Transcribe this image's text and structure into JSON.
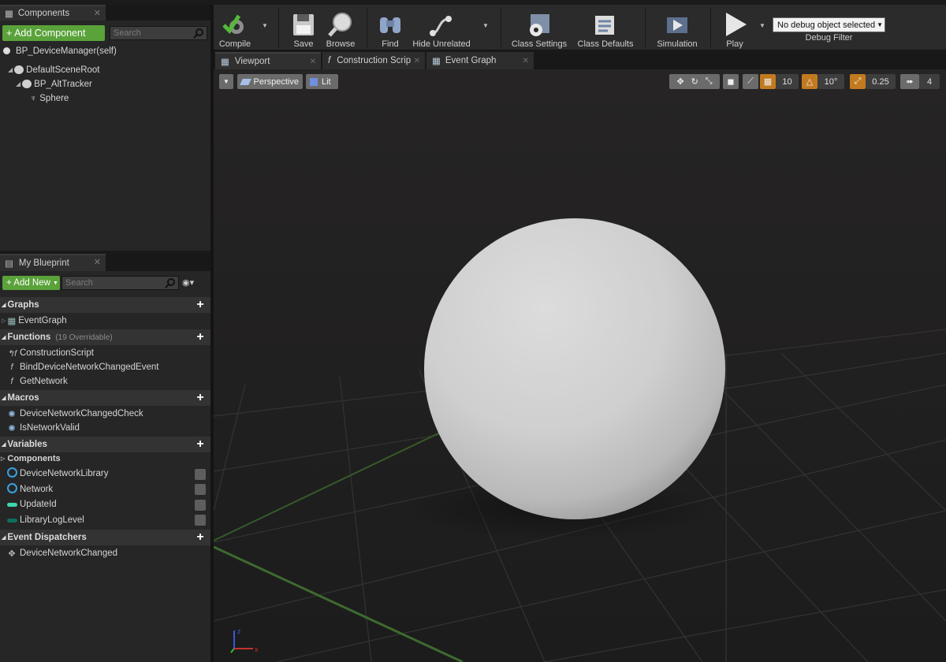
{
  "components_panel": {
    "tab_label": "Components",
    "add_component_label": "+ Add Component",
    "search_placeholder": "Search",
    "self_item": "BP_DeviceManager(self)",
    "tree": [
      "DefaultSceneRoot",
      "BP_AltTracker",
      "Sphere"
    ]
  },
  "my_blueprint": {
    "tab_label": "My Blueprint",
    "add_new_label": "+ Add New",
    "search_placeholder": "Search",
    "sections": {
      "graphs": "Graphs",
      "functions": "Functions",
      "functions_note": "(19 Overridable)",
      "macros": "Macros",
      "variables": "Variables",
      "components_sub": "Components",
      "event_dispatchers": "Event Dispatchers"
    },
    "graphs": [
      "EventGraph"
    ],
    "functions": [
      "ConstructionScript",
      "BindDeviceNetworkChangedEvent",
      "GetNetwork"
    ],
    "macros": [
      "DeviceNetworkChangedCheck",
      "IsNetworkValid"
    ],
    "variables": [
      "DeviceNetworkLibrary",
      "Network",
      "UpdateId",
      "LibraryLogLevel"
    ],
    "dispatchers": [
      "DeviceNetworkChanged"
    ]
  },
  "toolbar": {
    "compile": "Compile",
    "save": "Save",
    "browse": "Browse",
    "find": "Find",
    "hide_unrelated": "Hide Unrelated",
    "class_settings": "Class Settings",
    "class_defaults": "Class Defaults",
    "simulation": "Simulation",
    "play": "Play",
    "debug_select": "No debug object selected",
    "debug_filter": "Debug Filter"
  },
  "editor_tabs": [
    "Viewport",
    "Construction Scrip",
    "Event Graph"
  ],
  "viewport": {
    "perspective": "Perspective",
    "lit": "Lit",
    "grid_snap": "10",
    "rotation_snap": "10°",
    "scale_snap": "0.25",
    "camera_speed": "4"
  },
  "colors": {
    "accent_green": "#5aa23a",
    "snap_orange": "#c27a1f",
    "panel_bg": "#262626"
  }
}
